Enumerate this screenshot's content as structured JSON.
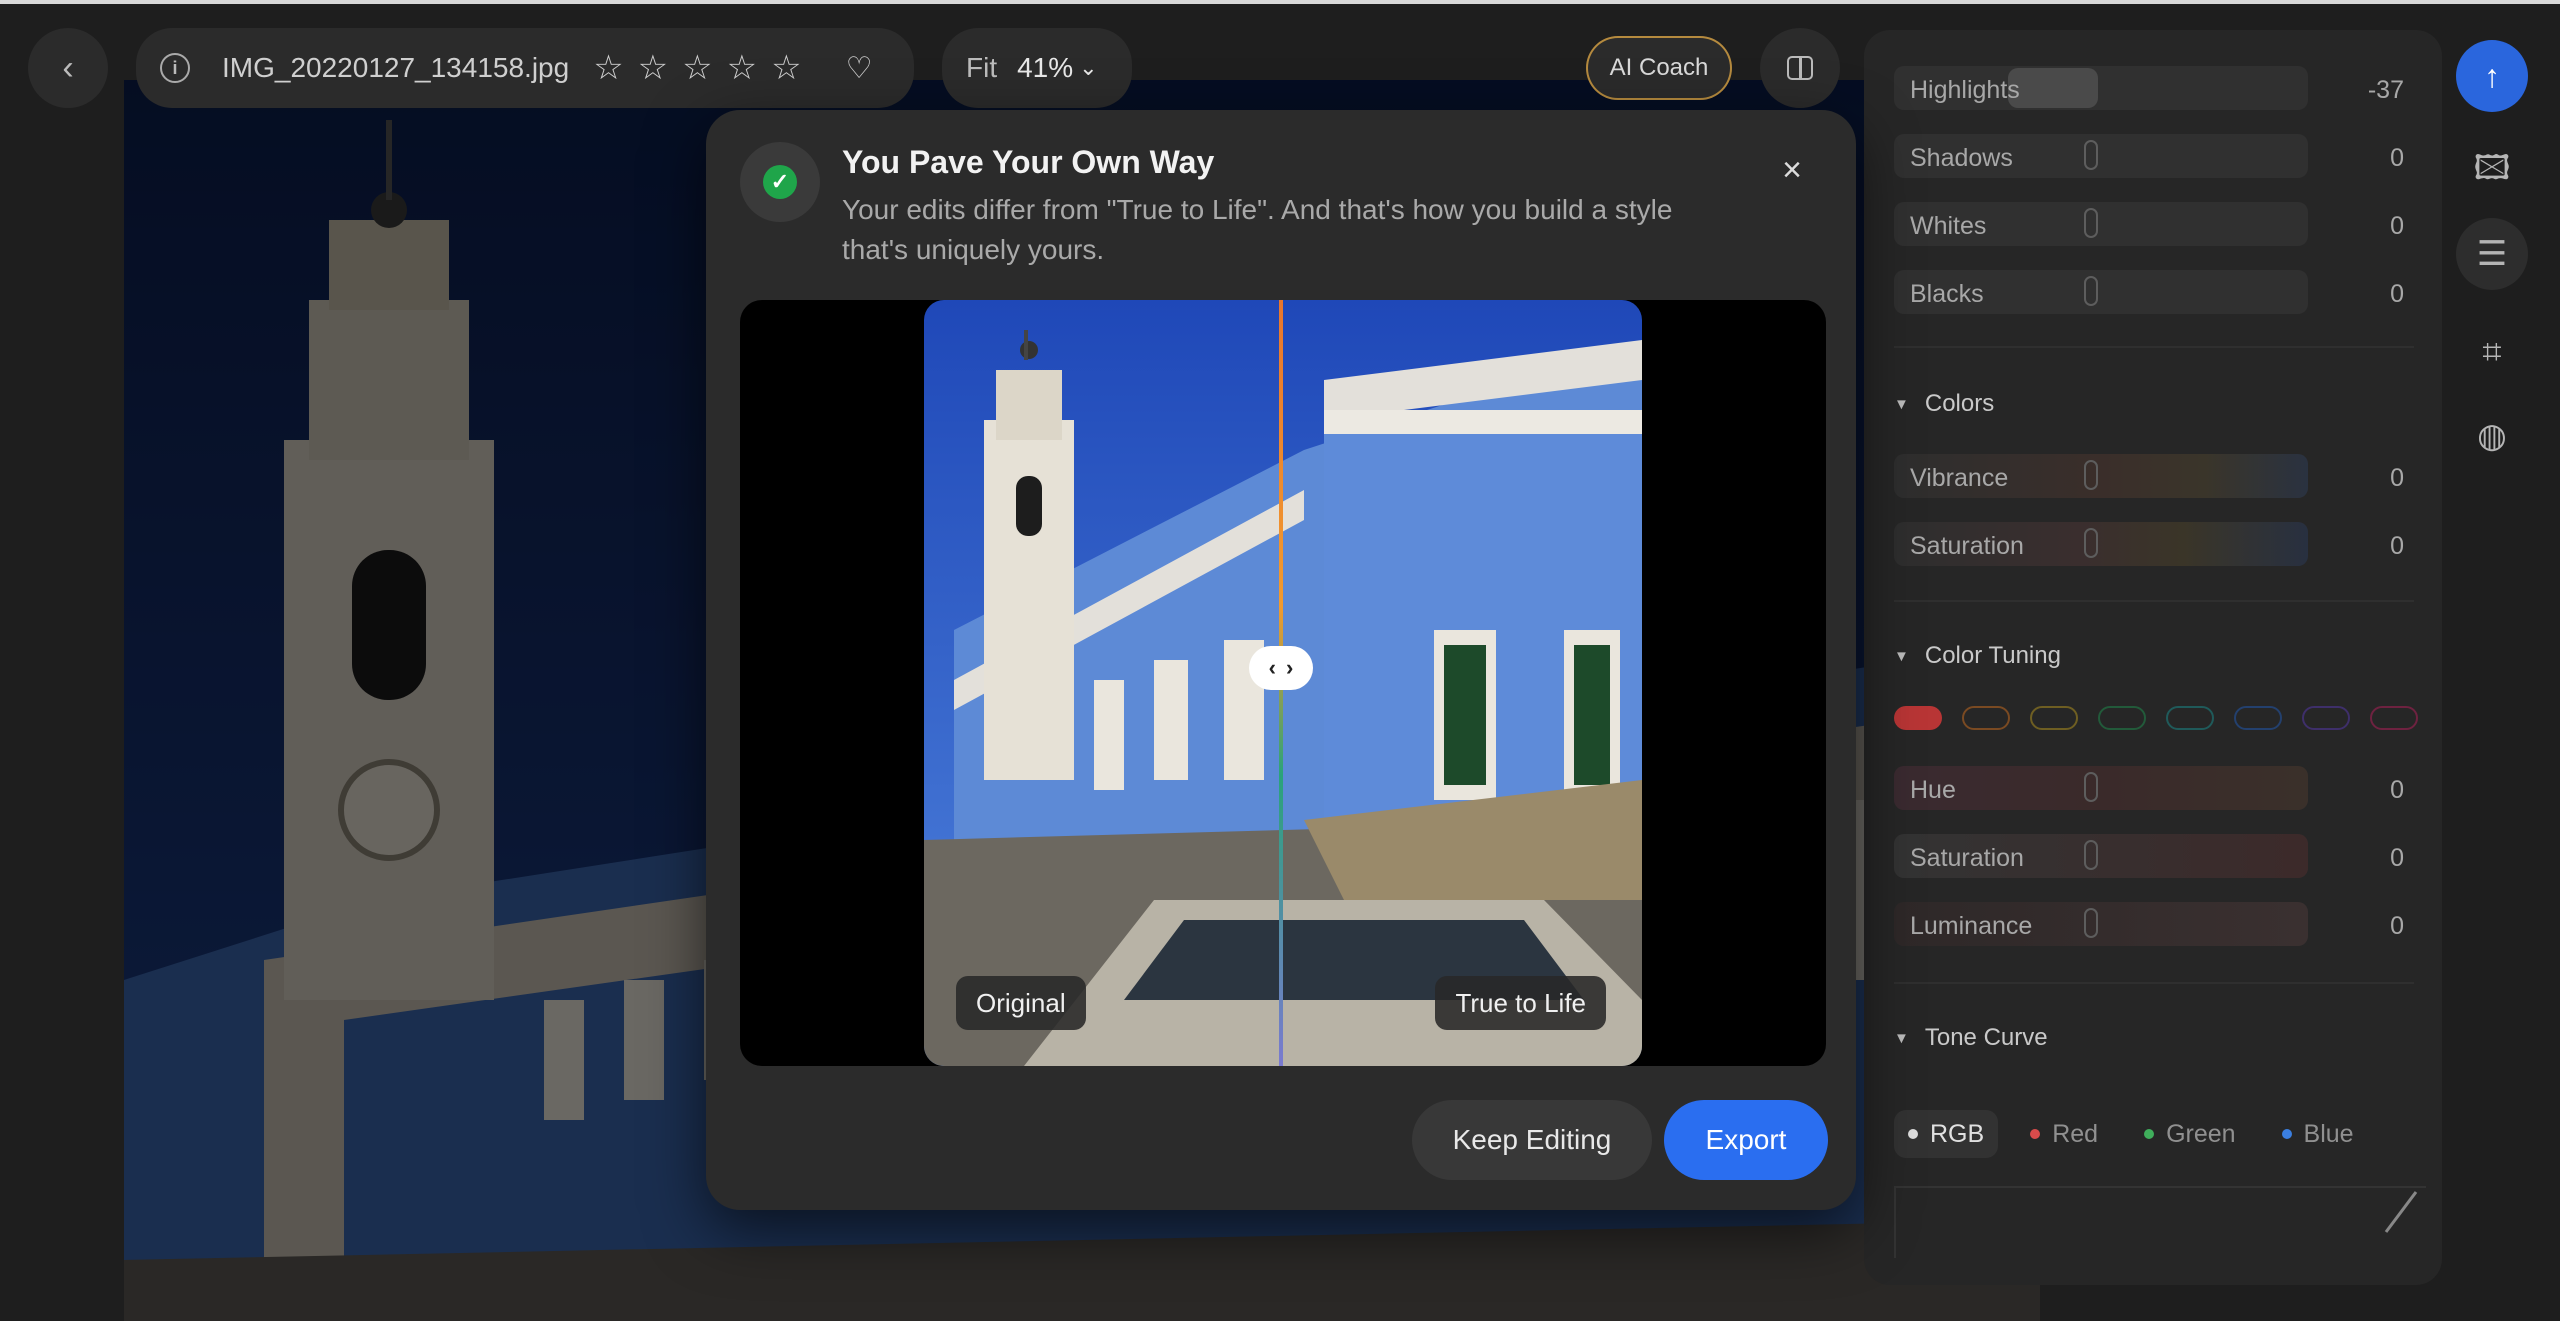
{
  "topbar": {
    "filename": "IMG_20220127_134158.jpg",
    "zoom_mode": "Fit",
    "zoom_value": "41%",
    "coach_label": "AI Coach",
    "rating_stars": 5
  },
  "panel": {
    "light_sliders": [
      {
        "label": "Highlights",
        "value": "-37"
      },
      {
        "label": "Shadows",
        "value": "0"
      },
      {
        "label": "Whites",
        "value": "0"
      },
      {
        "label": "Blacks",
        "value": "0"
      }
    ],
    "colors_title": "Colors",
    "color_sliders": [
      {
        "label": "Vibrance",
        "value": "0"
      },
      {
        "label": "Saturation",
        "value": "0"
      }
    ],
    "tuning_title": "Color Tuning",
    "tuning_swatches": [
      "#d63a3a",
      "#d97a26",
      "#c9a82a",
      "#3aa36a",
      "#2fa5a5",
      "#3a6fd1",
      "#7b4fd0",
      "#d13a80"
    ],
    "tuning_sliders": [
      {
        "label": "Hue",
        "value": "0"
      },
      {
        "label": "Saturation",
        "value": "0"
      },
      {
        "label": "Luminance",
        "value": "0"
      }
    ],
    "curve_title": "Tone Curve",
    "curve_channels": [
      {
        "label": "RGB",
        "color": "#dddddd"
      },
      {
        "label": "Red",
        "color": "#d84b4b"
      },
      {
        "label": "Green",
        "color": "#3fae5b"
      },
      {
        "label": "Blue",
        "color": "#3b7fe0"
      }
    ]
  },
  "modal": {
    "title": "You Pave Your Own Way",
    "description": "Your edits differ from \"True to Life\". And that's how you build a style that's uniquely yours.",
    "left_tag": "Original",
    "right_tag": "True to Life",
    "keep_label": "Keep Editing",
    "export_label": "Export"
  },
  "icons": {
    "back": "chevron-left-icon",
    "info": "info-icon",
    "star": "star-icon",
    "heart": "heart-icon",
    "close": "close-icon",
    "check": "check-icon",
    "export": "upload-icon"
  },
  "colors": {
    "accent": "#2a6ef0",
    "success": "#1fa54a",
    "panel_bg": "#262626"
  }
}
